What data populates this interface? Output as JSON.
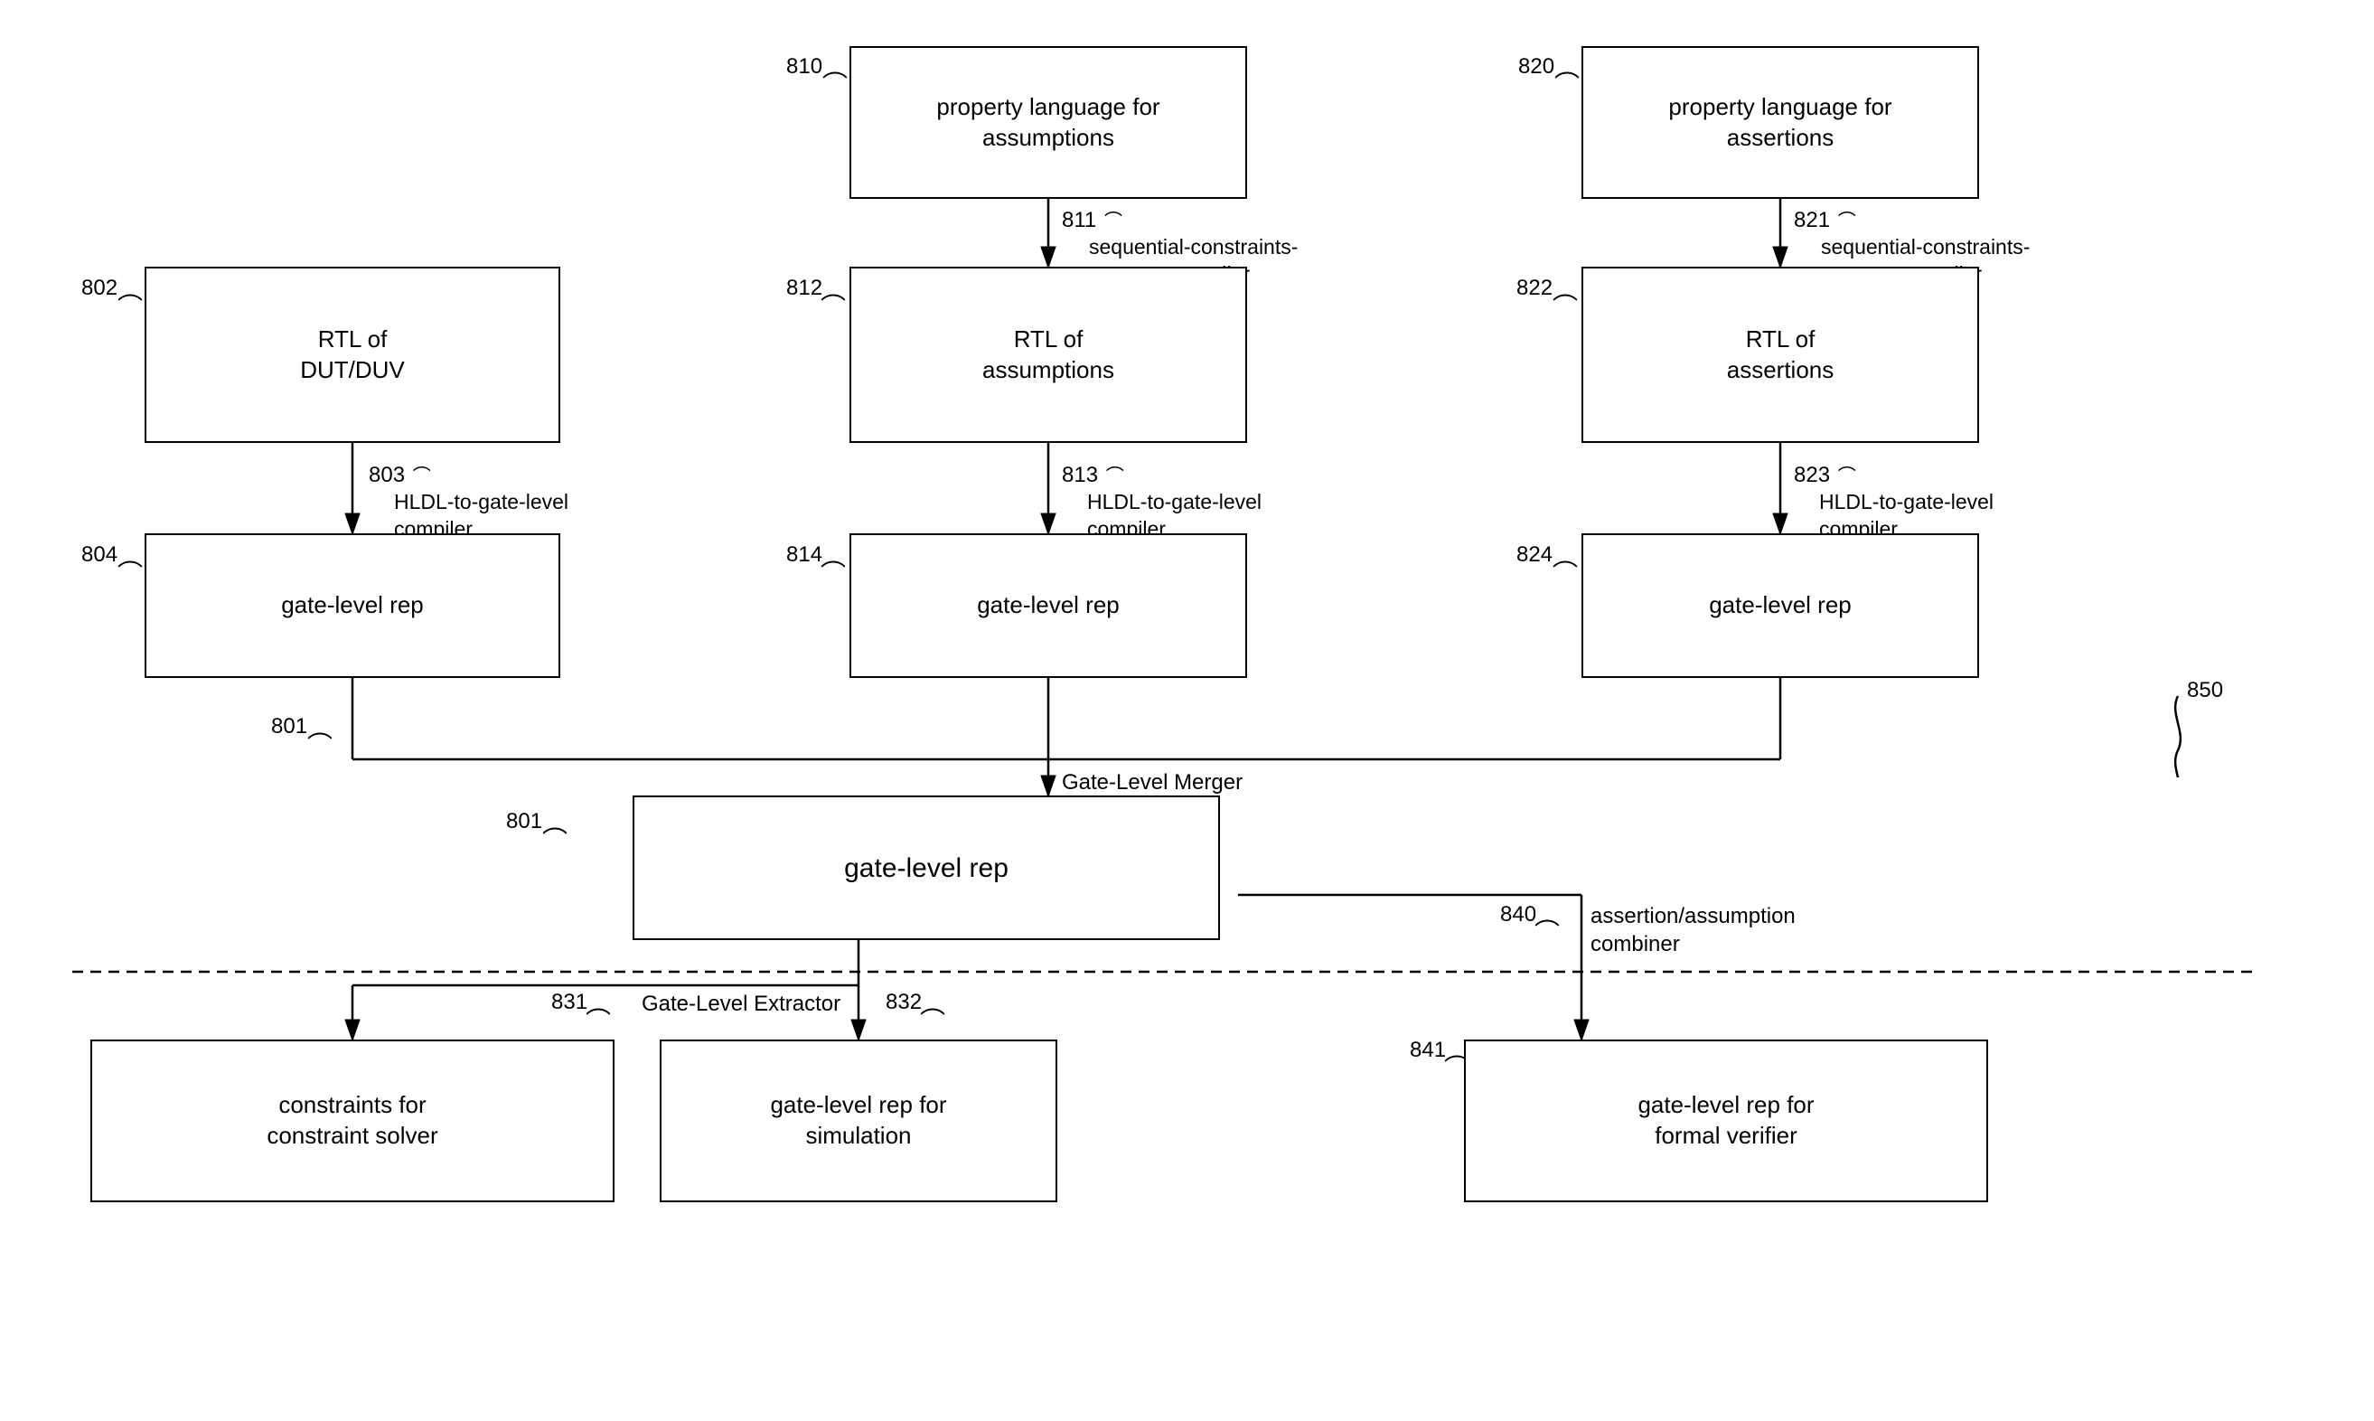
{
  "nodes": {
    "prop_assumptions": {
      "label": "property language for\nassumptions",
      "id": "810"
    },
    "prop_assertions": {
      "label": "property language for\nassertions",
      "id": "820"
    },
    "rtl_dut": {
      "label": "RTL of\nDUT/DUV",
      "id": "802"
    },
    "rtl_assumptions": {
      "label": "RTL of\nassumptions",
      "id": "812"
    },
    "rtl_assertions": {
      "label": "RTL of\nassertions",
      "id": "822"
    },
    "gate_dut": {
      "label": "gate-level rep",
      "id": "804"
    },
    "gate_assumptions": {
      "label": "gate-level rep",
      "id": "814"
    },
    "gate_assertions": {
      "label": "gate-level rep",
      "id": "824"
    },
    "gate_merged": {
      "label": "gate-level rep",
      "id": "801"
    },
    "constraints": {
      "label": "constraints for\nconstraint solver",
      "id": "831"
    },
    "gate_simulation": {
      "label": "gate-level rep for\nsimulation",
      "id": "832"
    },
    "gate_formal": {
      "label": "gate-level rep for\nformal verifier",
      "id": "841"
    }
  },
  "edge_labels": {
    "811": "sequential-constraints-\nto-HLDL compiler",
    "821": "sequential-constraints-\nto-HLDL compiler",
    "803": "HLDL-to-gate-level\ncompiler",
    "813": "HLDL-to-gate-level\ncompiler",
    "823": "HLDL-to-gate-level\ncompiler",
    "800": "Gate-Level Merger",
    "830": "Gate-Level Extractor",
    "840": "assertion/assumption\ncombiner"
  }
}
